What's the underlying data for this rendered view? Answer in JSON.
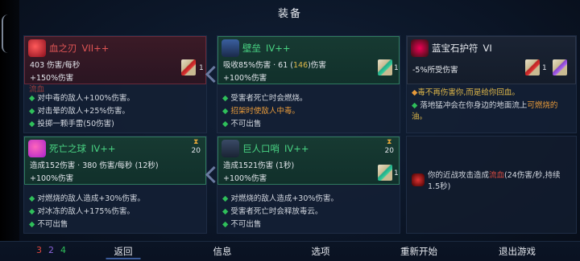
{
  "screen": {
    "title": "装备"
  },
  "cards": [
    {
      "name": "血之刃",
      "level": "VII++",
      "stat1": "403 伤害/每秒",
      "stat2": "+150%伤害",
      "count": "1",
      "lines": [
        [
          "txt-red",
          "流血"
        ],
        [
          "",
          "对中毒的敌人+100%伤害。"
        ],
        [
          "",
          "对击晕的敌人+25%伤害。"
        ],
        [
          "",
          "投掷一颗手雷(50伤害)"
        ]
      ]
    },
    {
      "name": "壁垒",
      "level": "IV++",
      "stat1a": "吸收85%伤害 · 61 (",
      "stat1b": "146",
      "stat1c": ")伤害",
      "stat2": "+100%伤害",
      "count": "1",
      "lines": [
        [
          "",
          "受害者死亡时会燃烧。"
        ],
        [
          "",
          "招架时使敌人中毒。"
        ],
        [
          "",
          "不可出售"
        ]
      ]
    },
    {
      "name": "蓝宝石护符",
      "level": "VI",
      "stat1": "-5%所受伤害",
      "count": "1",
      "desc_a": "毒不再伤害你,而是给你回血。",
      "desc_b": "落地猛冲会在你身边的地面流上",
      "desc_c": "可燃烧的",
      "desc_d": "油。"
    },
    {
      "name": "死亡之球",
      "level": "IV++",
      "stat1": "造成152伤害 · 380 伤害/每秒 (12秒)",
      "stat2": "+100%伤害",
      "timer": "20",
      "lines": [
        [
          "",
          "对燃烧的敌人造成+30%伤害。"
        ],
        [
          "",
          "对冰冻的敌人+175%伤害。"
        ],
        [
          "",
          "不可出售"
        ]
      ]
    },
    {
      "name": "巨人口哨",
      "level": "IV++",
      "stat1": "造成1521伤害 (1秒)",
      "stat2": "+100%伤害",
      "timer": "20",
      "count": "1",
      "lines": [
        [
          "",
          "对燃烧的敌人造成+30%伤害。"
        ],
        [
          "",
          "受害者死亡时会释放毒云。"
        ],
        [
          "",
          "不可出售"
        ]
      ]
    },
    {
      "desc_a": "你的近战攻击造成",
      "desc_b": "流血",
      "desc_c": "(24伤害/秒,持续",
      "desc_d": "1.5秒)"
    }
  ],
  "bottom": {
    "n1": "3",
    "n2": "2",
    "n3": "4",
    "back": "返回",
    "info": "信息",
    "options": "选项",
    "restart": "重新开始",
    "quit": "退出游戏"
  },
  "colors": {
    "brutality": "#e0473e",
    "tactics": "#8a63d9",
    "survival": "#2fbf5a"
  }
}
